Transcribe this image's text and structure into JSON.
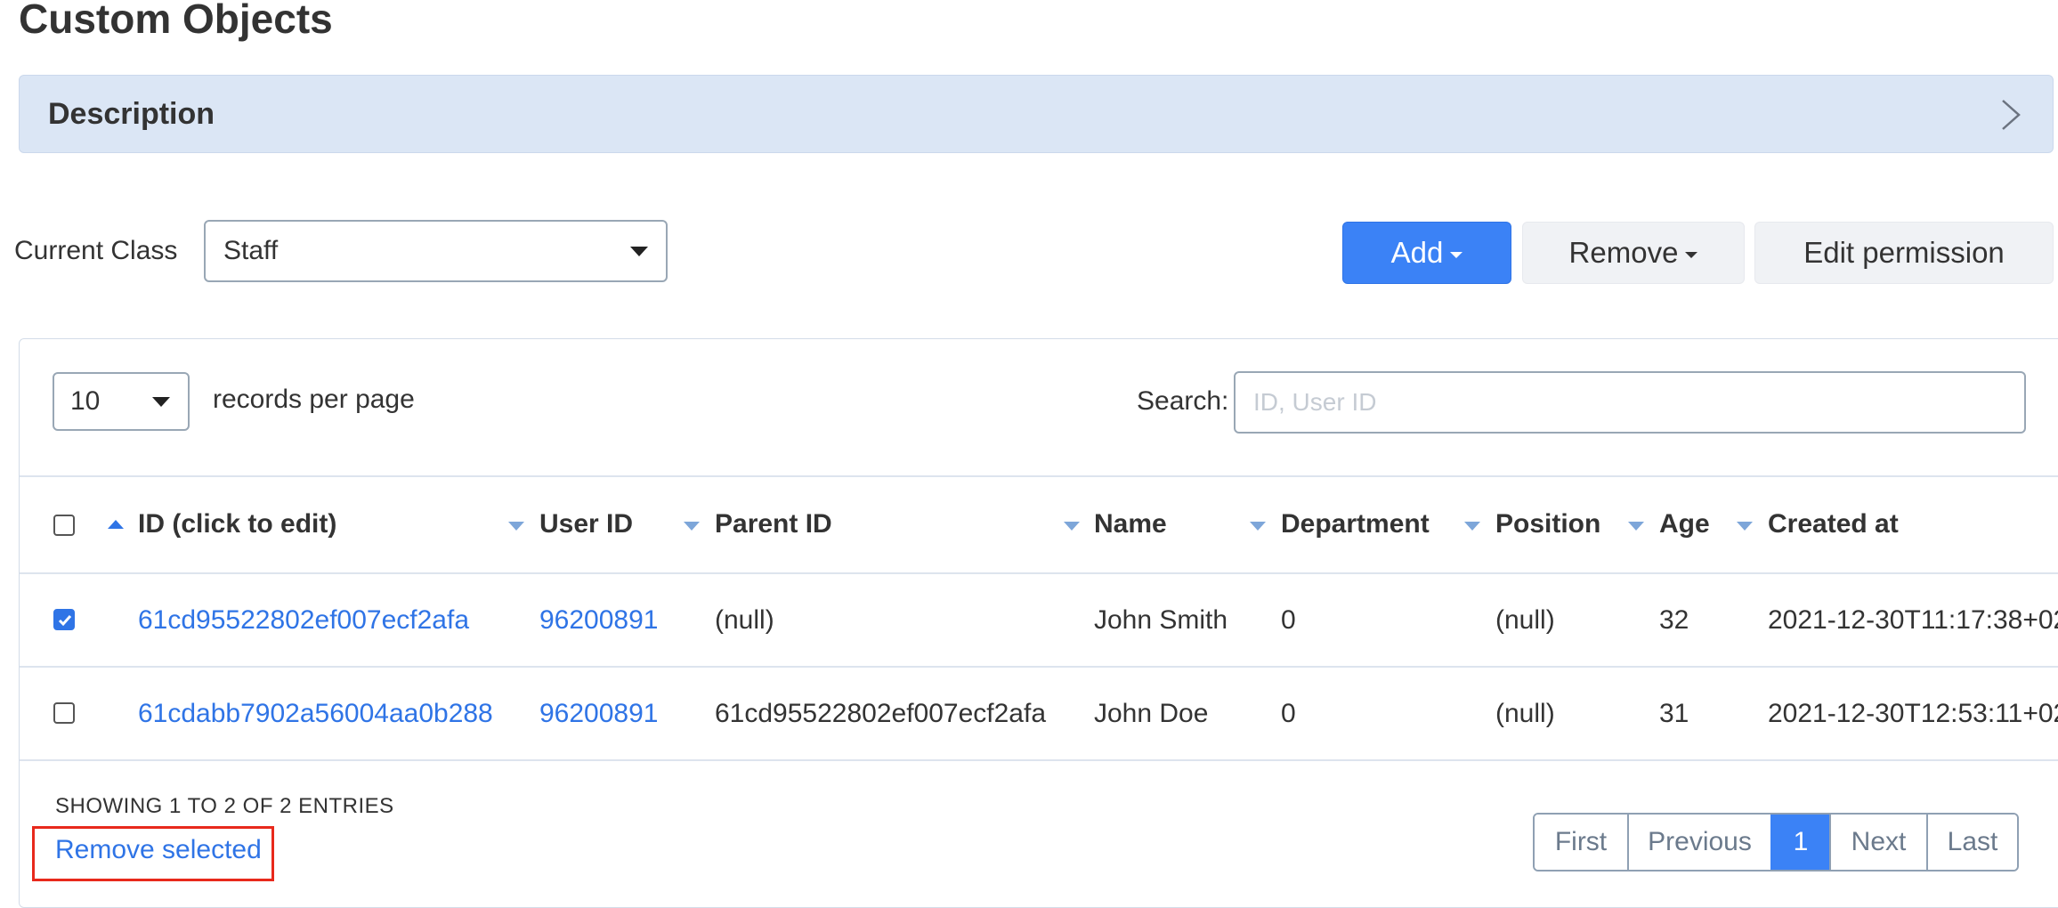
{
  "page": {
    "title": "Custom Objects"
  },
  "description": {
    "title": "Description"
  },
  "current_class": {
    "label": "Current Class",
    "selected": "Staff"
  },
  "toolbar": {
    "add_label": "Add",
    "remove_label": "Remove",
    "edit_permission_label": "Edit permission"
  },
  "table_controls": {
    "per_page_value": "10",
    "per_page_label": "records per page",
    "search_label": "Search:",
    "search_placeholder": "ID, User ID",
    "search_value": ""
  },
  "table": {
    "columns": [
      "ID (click to edit)",
      "User ID",
      "Parent ID",
      "Name",
      "Department",
      "Position",
      "Age",
      "Created at"
    ],
    "sorted_column": "ID (click to edit)",
    "rows": [
      {
        "checked": true,
        "id": "61cd95522802ef007ecf2afa",
        "user_id": "96200891",
        "parent_id": "(null)",
        "name": "John Smith",
        "department": "0",
        "position": "(null)",
        "age": "32",
        "created_at": "2021-12-30T11:17:38+02"
      },
      {
        "checked": false,
        "id": "61cdabb7902a56004aa0b288",
        "user_id": "96200891",
        "parent_id": "61cd95522802ef007ecf2afa",
        "name": "John Doe",
        "department": "0",
        "position": "(null)",
        "age": "31",
        "created_at": "2021-12-30T12:53:11+02"
      }
    ]
  },
  "footer": {
    "showing_text": "SHOWING 1 TO 2 OF 2 ENTRIES",
    "remove_selected_label": "Remove selected"
  },
  "pagination": {
    "first": "First",
    "previous": "Previous",
    "current": "1",
    "next": "Next",
    "last": "Last"
  },
  "colors": {
    "accent": "#3b82f6",
    "link": "#2f74e6",
    "highlight_box": "#e8291c",
    "description_bg": "#dbe6f5"
  },
  "icons": {
    "description_toggle": "chevron-right-icon",
    "dropdown": "caret-down-icon",
    "sort": "sort-triangle-icon"
  }
}
